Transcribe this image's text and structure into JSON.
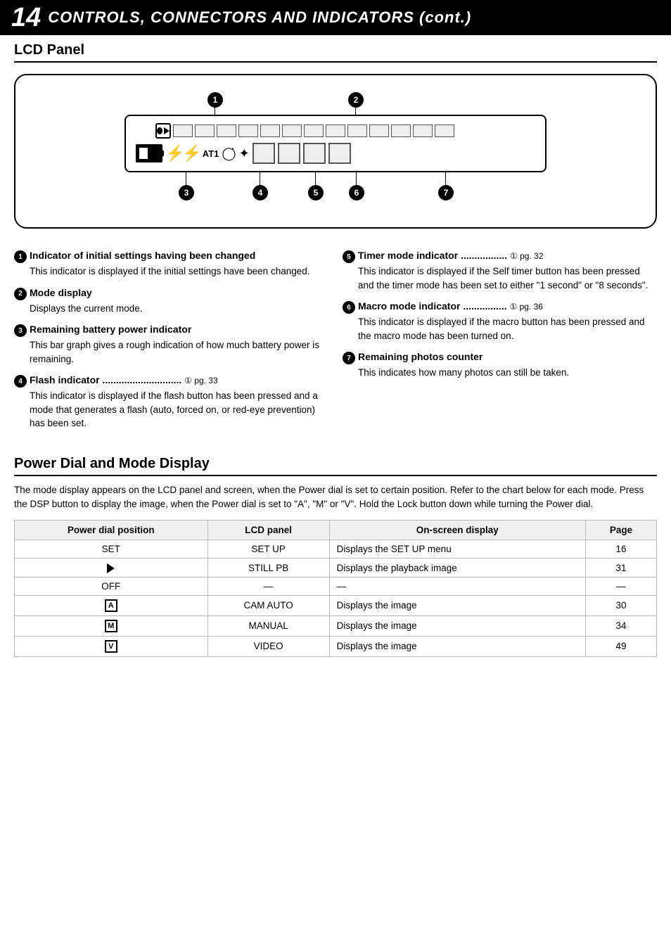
{
  "header": {
    "page_number": "14",
    "title": "CONTROLS, CONNECTORS AND INDICATORS (cont.)"
  },
  "lcd_section": {
    "title": "LCD Panel"
  },
  "items": [
    {
      "num": "1",
      "title": "Indicator of initial settings having been changed",
      "body": "This indicator is displayed if the initial settings have been changed."
    },
    {
      "num": "2",
      "title": "Mode display",
      "body": "Displays the current mode."
    },
    {
      "num": "3",
      "title": "Remaining battery power indicator",
      "body": "This bar graph gives a rough indication of how much battery power is remaining."
    },
    {
      "num": "4",
      "title": "Flash indicator .............................",
      "ref": "pg. 33",
      "body": "This indicator is displayed if the flash button has been pressed and a mode that generates a flash (auto, forced on, or red-eye prevention) has been set."
    },
    {
      "num": "5",
      "title": "Timer mode indicator .................",
      "ref": "pg. 32",
      "body": "This indicator is displayed if the Self timer button has been pressed and the timer mode has been set to either \"1 second\" or \"8 seconds\"."
    },
    {
      "num": "6",
      "title": "Macro mode indicator ................",
      "ref": "pg. 36",
      "body": "This indicator is displayed if the macro button has been pressed and the macro mode has been turned on."
    },
    {
      "num": "7",
      "title": "Remaining photos counter",
      "body": "This indicates how many photos can still be taken."
    }
  ],
  "power_section": {
    "title": "Power Dial and Mode Display",
    "description": "The mode display appears on the LCD panel and screen, when the Power dial is set to certain position. Refer to the chart below for each mode. Press the DSP button to display the image, when the Power dial is set to \"A\", \"M\" or \"V\". Hold the Lock button down while turning the Power dial.",
    "table": {
      "headers": [
        "Power dial position",
        "LCD panel",
        "On-screen display",
        "Page"
      ],
      "rows": [
        {
          "dial": "SET",
          "lcd": "SET UP",
          "screen": "Displays the SET UP menu",
          "page": "16"
        },
        {
          "dial": "PLAY",
          "lcd": "STILL PB",
          "screen": "Displays the playback image",
          "page": "31"
        },
        {
          "dial": "OFF",
          "lcd": "—",
          "screen": "—",
          "page": "—"
        },
        {
          "dial": "A_BOX",
          "lcd": "CAM AUTO",
          "screen": "Displays the image",
          "page": "30"
        },
        {
          "dial": "M_BOX",
          "lcd": "MANUAL",
          "screen": "Displays the image",
          "page": "34"
        },
        {
          "dial": "V_BOX",
          "lcd": "VIDEO",
          "screen": "Displays the image",
          "page": "49"
        }
      ]
    }
  }
}
